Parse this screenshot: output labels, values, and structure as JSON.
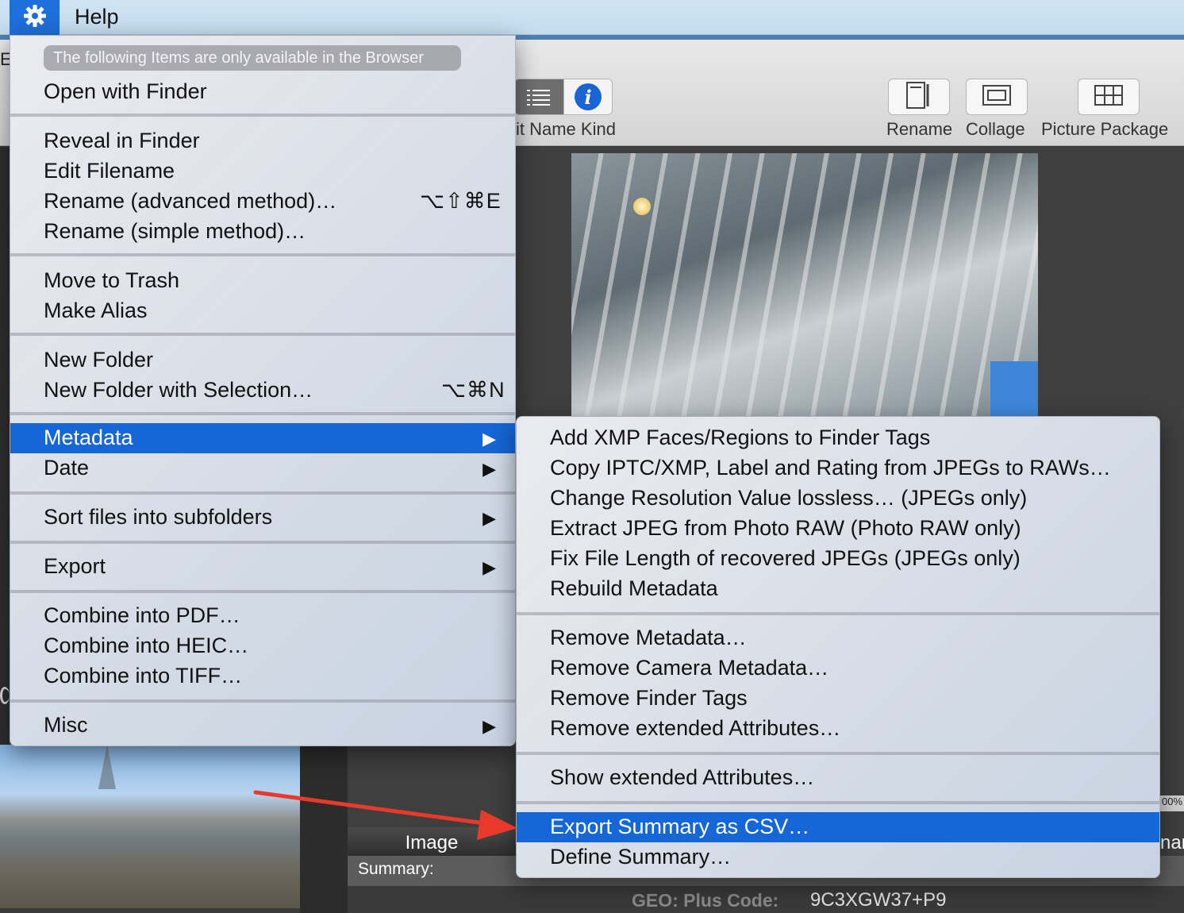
{
  "menubar": {
    "help_label": "Help",
    "gear_icon": "gear-icon",
    "accent_color": "#1e6fd9"
  },
  "toolbar": {
    "edge_label": "Ei",
    "columns_label": "it Name Kind",
    "rename_label": "Rename",
    "collage_label": "Collage",
    "picture_package_label": "Picture Package"
  },
  "main_menu": {
    "info_pill": "The following Items are only available in the Browser",
    "items": [
      {
        "label": "Open with Finder",
        "shortcut": "",
        "submenu": false
      },
      {
        "label": "Reveal in Finder",
        "shortcut": "",
        "submenu": false
      },
      {
        "label": "Edit Filename",
        "shortcut": "",
        "submenu": false
      },
      {
        "label": "Rename (advanced method)…",
        "shortcut": "⌥⇧⌘E",
        "submenu": false
      },
      {
        "label": "Rename (simple method)…",
        "shortcut": "",
        "submenu": false
      },
      {
        "label": "Move to Trash",
        "shortcut": "",
        "submenu": false
      },
      {
        "label": "Make Alias",
        "shortcut": "",
        "submenu": false
      },
      {
        "label": "New Folder",
        "shortcut": "",
        "submenu": false
      },
      {
        "label": "New Folder with Selection…",
        "shortcut": "⌥⌘N",
        "submenu": false
      },
      {
        "label": "Metadata",
        "shortcut": "",
        "submenu": true,
        "highlighted": true
      },
      {
        "label": "Date",
        "shortcut": "",
        "submenu": true
      },
      {
        "label": "Sort files into subfolders",
        "shortcut": "",
        "submenu": true
      },
      {
        "label": "Export",
        "shortcut": "",
        "submenu": true
      },
      {
        "label": "Combine into PDF…",
        "shortcut": "",
        "submenu": false
      },
      {
        "label": "Combine into HEIC…",
        "shortcut": "",
        "submenu": false
      },
      {
        "label": "Combine into TIFF…",
        "shortcut": "",
        "submenu": false
      },
      {
        "label": "Misc",
        "shortcut": "",
        "submenu": true
      }
    ]
  },
  "metadata_submenu": {
    "items": [
      {
        "label": "Add XMP Faces/Regions to Finder Tags"
      },
      {
        "label": "Copy IPTC/XMP, Label and Rating from JPEGs to RAWs…"
      },
      {
        "label": "Change Resolution Value lossless… (JPEGs only)"
      },
      {
        "label": "Extract JPEG from Photo RAW (Photo RAW only)"
      },
      {
        "label": "Fix File Length of recovered JPEGs (JPEGs only)"
      },
      {
        "label": "Rebuild Metadata"
      },
      {
        "label": "Remove Metadata…"
      },
      {
        "label": "Remove Camera Metadata…"
      },
      {
        "label": "Remove Finder Tags"
      },
      {
        "label": "Remove extended Attributes…"
      },
      {
        "label": "Show extended Attributes…"
      },
      {
        "label": "Export Summary as CSV…",
        "highlighted": true
      },
      {
        "label": "Define Summary…"
      }
    ]
  },
  "viewer": {
    "image_tab_label": "Image",
    "summary_label": "Summary:",
    "geo_label": "GEO: Plus Code:",
    "geo_value": "9C3XGW37+P9",
    "zoom_fragment": "00%",
    "right_fragment": "nar"
  },
  "colors": {
    "highlight": "#1566d6",
    "annotation_arrow": "#e8392b"
  }
}
